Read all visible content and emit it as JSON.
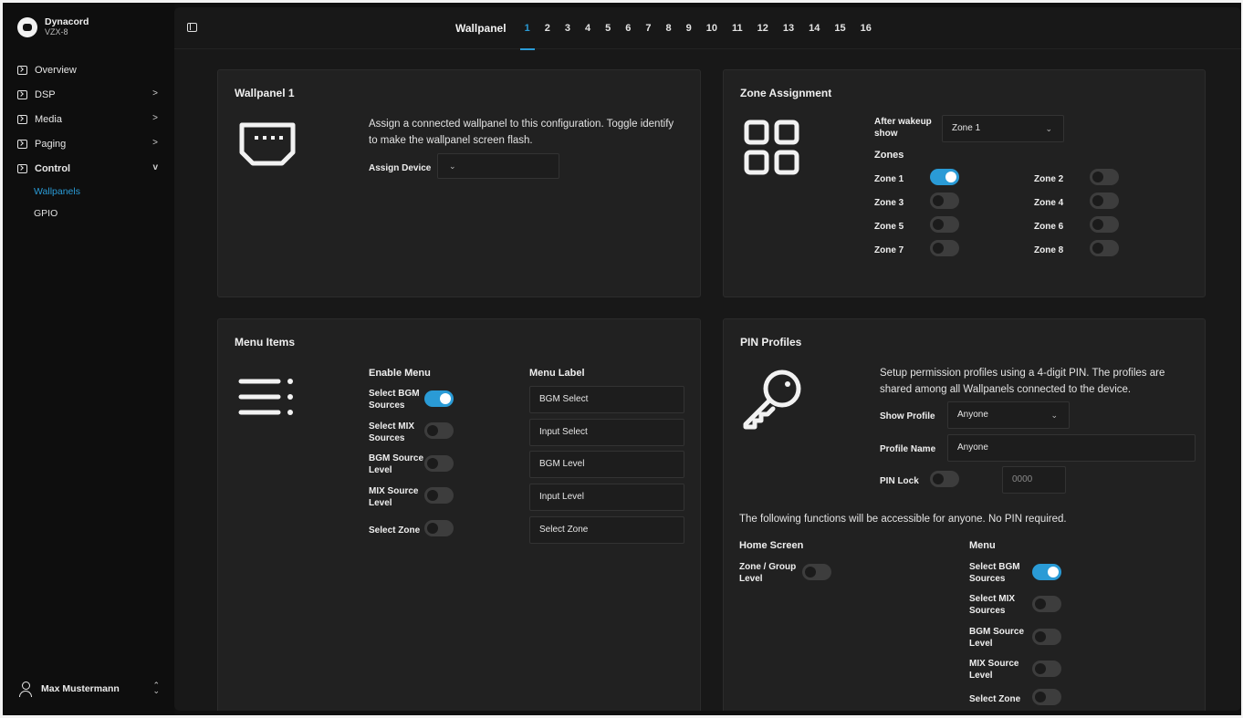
{
  "brand": {
    "name": "Dynacord",
    "model": "VZX-8"
  },
  "sidebar": {
    "items": [
      {
        "label": "Overview",
        "has_chevron": false
      },
      {
        "label": "DSP",
        "has_chevron": true,
        "chevron": ">"
      },
      {
        "label": "Media",
        "has_chevron": true,
        "chevron": ">"
      },
      {
        "label": "Paging",
        "has_chevron": true,
        "chevron": ">"
      },
      {
        "label": "Control",
        "has_chevron": true,
        "chevron": "v",
        "expanded": true
      }
    ],
    "sub_items": [
      {
        "label": "Wallpanels",
        "active": true
      },
      {
        "label": "GPIO",
        "active": false
      }
    ],
    "user": {
      "name": "Max Mustermann"
    }
  },
  "tabs": {
    "title": "Wallpanel",
    "items": [
      "1",
      "2",
      "3",
      "4",
      "5",
      "6",
      "7",
      "8",
      "9",
      "10",
      "11",
      "12",
      "13",
      "14",
      "15",
      "16"
    ],
    "active_index": 0
  },
  "wallpanel": {
    "title": "Wallpanel 1",
    "icon": "ethernet-port-icon",
    "description": "Assign a connected wallpanel to this configuration. Toggle identify to make the wallpanel screen flash.",
    "assign_label": "Assign Device",
    "assign_value": ""
  },
  "zone_assignment": {
    "title": "Zone Assignment",
    "icon": "grid-icon",
    "after_wakeup_label": "After wakeup show",
    "after_wakeup_value": "Zone 1",
    "zones_heading": "Zones",
    "zones": [
      {
        "label": "Zone 1",
        "on": true
      },
      {
        "label": "Zone 2",
        "on": false
      },
      {
        "label": "Zone 3",
        "on": false
      },
      {
        "label": "Zone 4",
        "on": false
      },
      {
        "label": "Zone 5",
        "on": false
      },
      {
        "label": "Zone 6",
        "on": false
      },
      {
        "label": "Zone 7",
        "on": false
      },
      {
        "label": "Zone 8",
        "on": false
      }
    ]
  },
  "menu_items": {
    "title": "Menu Items",
    "icon": "menu-list-icon",
    "enable_heading": "Enable Menu",
    "label_heading": "Menu Label",
    "rows": [
      {
        "label": "Select BGM Sources",
        "on": true,
        "menu_label": "BGM Select"
      },
      {
        "label": "Select MIX Sources",
        "on": false,
        "menu_label": "Input Select"
      },
      {
        "label": "BGM Source Level",
        "on": false,
        "menu_label": "BGM Level"
      },
      {
        "label": "MIX Source Level",
        "on": false,
        "menu_label": "Input Level"
      },
      {
        "label": "Select Zone",
        "on": false,
        "menu_label": "Select Zone"
      }
    ]
  },
  "pin_profiles": {
    "title": "PIN Profiles",
    "icon": "key-icon",
    "description": "Setup permission profiles using a 4-digit PIN. The profiles are shared among all Wallpanels connected to the device.",
    "show_profile_label": "Show Profile",
    "show_profile_value": "Anyone",
    "profile_name_label": "Profile Name",
    "profile_name_value": "Anyone",
    "pin_lock_label": "PIN Lock",
    "pin_lock_on": false,
    "pin_placeholder": "0000",
    "notice": "The following functions will be accessible for anyone. No PIN required.",
    "home_heading": "Home Screen",
    "home_rows": [
      {
        "label": "Zone / Group Level",
        "on": false
      }
    ],
    "menu_heading": "Menu",
    "menu_rows": [
      {
        "label": "Select BGM Sources",
        "on": true
      },
      {
        "label": "Select MIX Sources",
        "on": false
      },
      {
        "label": "BGM Source Level",
        "on": false
      },
      {
        "label": "MIX Source Level",
        "on": false
      },
      {
        "label": "Select Zone",
        "on": false
      }
    ]
  },
  "colors": {
    "accent": "#2a9bd6",
    "background": "#101010",
    "card": "#212121"
  }
}
